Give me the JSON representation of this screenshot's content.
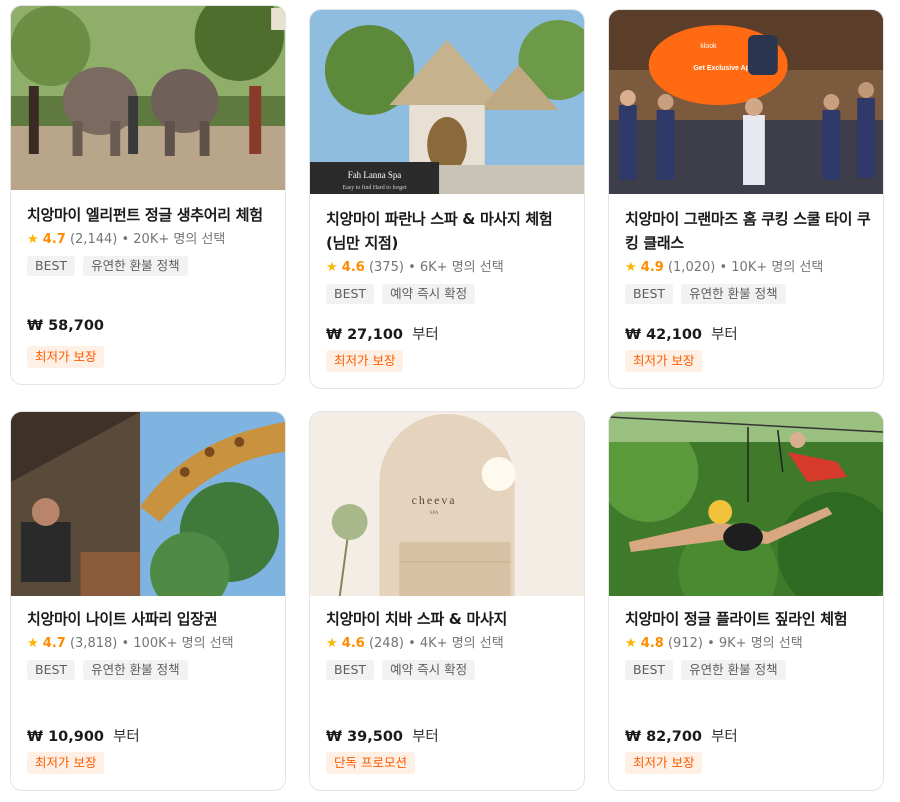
{
  "currency": "₩",
  "cards": [
    {
      "title": "치앙마이 엘리펀트 정글 생추어리 체험",
      "rating": "4.7",
      "reviews": "(2,144)",
      "booked": "• 20K+ 명의 선택",
      "tags": [
        "BEST",
        "유연한 환불 정책"
      ],
      "price": "58,700",
      "price_suffix": "",
      "promo": "최저가 보장",
      "image_icon": "elephant-sanctuary-photo"
    },
    {
      "title": "치앙마이 파란나 스파 & 마사지 체험 (님만 지점)",
      "rating": "4.6",
      "reviews": "(375)",
      "booked": "• 6K+ 명의 선택",
      "tags": [
        "BEST",
        "예약 즉시 확정"
      ],
      "price": "27,100",
      "price_suffix": "부터",
      "promo": "최저가 보장",
      "image_caption": "Fah Lanna Spa",
      "image_subcaption": "Easy to find  Hard to forget",
      "image_icon": "spa-building-photo"
    },
    {
      "title": "치앙마이 그랜마즈 홈 쿠킹 스쿨 타이 쿠킹 클래스",
      "rating": "4.9",
      "reviews": "(1,020)",
      "booked": "• 10K+ 명의 선택",
      "tags": [
        "BEST",
        "유연한 환불 정책"
      ],
      "price": "42,100",
      "price_suffix": "부터",
      "promo": "최저가 보장",
      "image_badge_brand": "klook",
      "image_badge_text": "Get Exclusive Apron",
      "image_icon": "cooking-class-photo"
    },
    {
      "title": "치앙마이 나이트 사파리 입장권",
      "rating": "4.7",
      "reviews": "(3,818)",
      "booked": "• 100K+ 명의 선택",
      "tags": [
        "BEST",
        "유연한 환불 정책"
      ],
      "price": "10,900",
      "price_suffix": "부터",
      "promo": "최저가 보장",
      "image_icon": "giraffe-safari-photo"
    },
    {
      "title": "치앙마이 치바 스파 & 마사지",
      "rating": "4.6",
      "reviews": "(248)",
      "booked": "• 4K+ 명의 선택",
      "tags": [
        "BEST",
        "예약 즉시 확정"
      ],
      "price": "39,500",
      "price_suffix": "부터",
      "promo": "단독 프로모션",
      "image_caption": "cheeva",
      "image_subcaption": "SPA",
      "image_icon": "spa-interior-photo"
    },
    {
      "title": "치앙마이 정글 플라이트 짚라인 체험",
      "rating": "4.8",
      "reviews": "(912)",
      "booked": "• 9K+ 명의 선택",
      "tags": [
        "BEST",
        "유연한 환불 정책"
      ],
      "price": "82,700",
      "price_suffix": "부터",
      "promo": "최저가 보장",
      "image_icon": "zipline-photo"
    }
  ]
}
